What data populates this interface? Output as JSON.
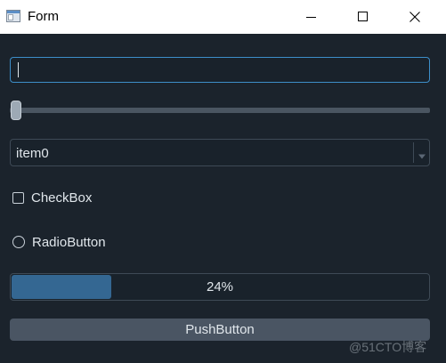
{
  "window": {
    "title": "Form"
  },
  "line_edit": {
    "value": ""
  },
  "slider": {
    "value": 0,
    "min": 0,
    "max": 99
  },
  "combo": {
    "selected": "item0"
  },
  "checkbox": {
    "label": "CheckBox",
    "checked": false
  },
  "radio": {
    "label": "RadioButton",
    "checked": false
  },
  "progress": {
    "value": 24,
    "text": "24%"
  },
  "button": {
    "label": "PushButton"
  },
  "watermark": {
    "text": "@51CTO博客"
  },
  "colors": {
    "background": "#1b232c",
    "accent": "#346792",
    "focus_border": "#3d8ec9",
    "text": "#e0e6eb"
  }
}
